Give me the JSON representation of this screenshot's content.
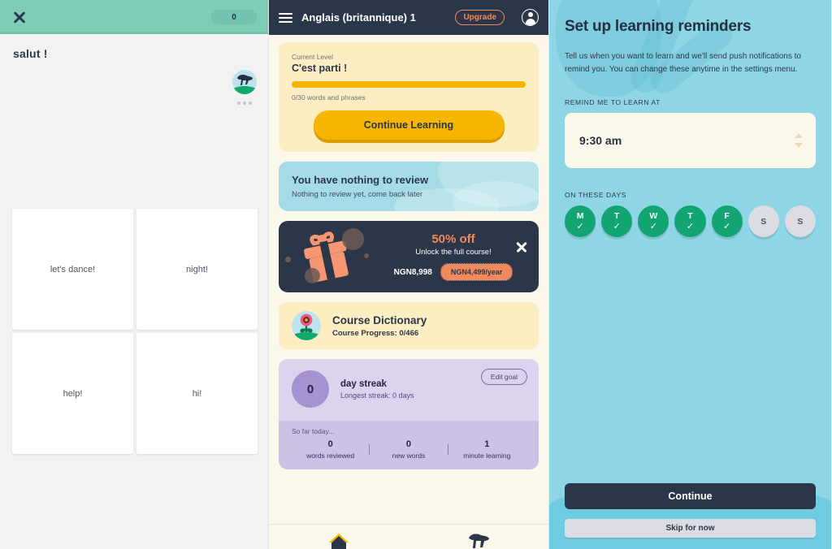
{
  "quiz": {
    "score": "0",
    "close_icon": "close-icon",
    "prompt": "salut !",
    "avatar_icon": "bear-avatar-icon",
    "typing_indicator": "typing-dots",
    "options": [
      {
        "label": "let's dance!"
      },
      {
        "label": "night!"
      },
      {
        "label": "help!"
      },
      {
        "label": "hi!"
      }
    ]
  },
  "dashboard": {
    "menu_icon": "hamburger-menu-icon",
    "title": "Anglais (britannique) 1",
    "upgrade_label": "Upgrade",
    "profile_icon": "profile-avatar-icon",
    "level": {
      "kicker": "Current Level",
      "name": "C'est parti !",
      "progress_label": "0/30 words and phrases",
      "progress_percent": 100,
      "cta": "Continue Learning"
    },
    "review": {
      "title": "You have nothing to review",
      "subtitle": "Nothing to review yet, come back later"
    },
    "promo": {
      "gift_icon": "gift-icon",
      "discount": "50% off",
      "unlock": "Unlock the full course!",
      "old_price": "NGN8,998",
      "new_price": "NGN4,499/year",
      "close_icon": "close-icon"
    },
    "dictionary": {
      "flower_icon": "flower-icon",
      "title": "Course Dictionary",
      "progress": "Course Progress: 0/466"
    },
    "streak": {
      "count": "0",
      "label": "day streak",
      "longest": "Longest streak: 0 days",
      "edit_goal": "Edit goal",
      "sofar": "So far today...",
      "stats": [
        {
          "num": "0",
          "cap": "words reviewed"
        },
        {
          "num": "0",
          "cap": "new words"
        },
        {
          "num": "1",
          "cap": "minute learning"
        }
      ]
    },
    "nav": [
      {
        "icon": "home-icon"
      },
      {
        "icon": "bear-icon"
      }
    ]
  },
  "reminders": {
    "title": "Set up learning reminders",
    "description": "Tell us when you want to learn and we'll send push notifications to remind you. You can change these anytime in the settings menu.",
    "time_label": "REMIND ME TO LEARN AT",
    "time_value": "9:30 am",
    "spinner_up_icon": "chevron-up-icon",
    "spinner_down_icon": "chevron-down-icon",
    "days_label": "ON THESE DAYS",
    "days": [
      {
        "letter": "M",
        "selected": true,
        "check": "✓"
      },
      {
        "letter": "T",
        "selected": true,
        "check": "✓"
      },
      {
        "letter": "W",
        "selected": true,
        "check": "✓"
      },
      {
        "letter": "T",
        "selected": true,
        "check": "✓"
      },
      {
        "letter": "F",
        "selected": true,
        "check": "✓"
      },
      {
        "letter": "S",
        "selected": false,
        "check": ""
      },
      {
        "letter": "S",
        "selected": false,
        "check": ""
      }
    ],
    "continue_label": "Continue",
    "skip_label": "Skip for now"
  },
  "colors": {
    "quiz_header": "#7ecdb7",
    "dash_header": "#2b3648",
    "accent_yellow": "#f7b500",
    "accent_orange": "#f08a5d",
    "reminder_bg": "#8ed5e5",
    "day_selected": "#12a573"
  }
}
